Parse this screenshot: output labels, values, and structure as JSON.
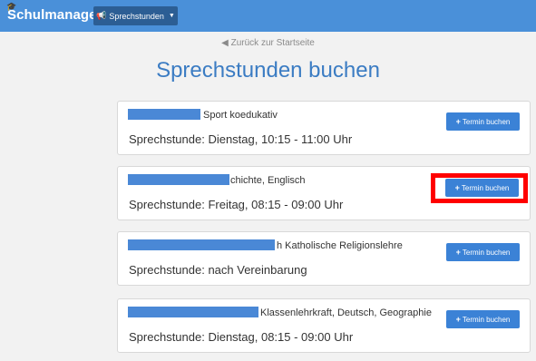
{
  "app": {
    "brand": "Schulmanager",
    "nav_menu_label": "Sprechstunden"
  },
  "page": {
    "back_link": "Zurück zur Startseite",
    "title": "Sprechstunden buchen"
  },
  "teachers": [
    {
      "name_visible": "",
      "subjects": "Sport koedukativ",
      "office_hours": "Sprechstunde: Dienstag, 10:15 - 11:00 Uhr",
      "button_label": "Termin buchen"
    },
    {
      "name_visible": "",
      "subjects": "chichte, Englisch",
      "office_hours": "Sprechstunde: Freitag, 08:15 - 09:00 Uhr",
      "button_label": "Termin buchen",
      "highlighted": true
    },
    {
      "name_visible": "",
      "subjects": "h Katholische Religionslehre",
      "office_hours": "Sprechstunde: nach Vereinbarung",
      "button_label": "Termin buchen"
    },
    {
      "name_visible": "",
      "subjects": "Klassenlehrkraft, Deutsch, Geographie",
      "office_hours": "Sprechstunde: Dienstag, 08:15 - 09:00 Uhr",
      "button_label": "Termin buchen"
    }
  ],
  "colors": {
    "navbar": "#4a90d9",
    "nav_pill": "#2c5e94",
    "title": "#3b7cc3",
    "button": "#3b82d6",
    "highlight": "#ff0000",
    "redaction": "#4a88d6"
  },
  "icons": {
    "brand": "graduation-cap-icon",
    "nav": "megaphone-icon",
    "back": "circle-arrow-left-icon",
    "button": "plus-icon"
  }
}
